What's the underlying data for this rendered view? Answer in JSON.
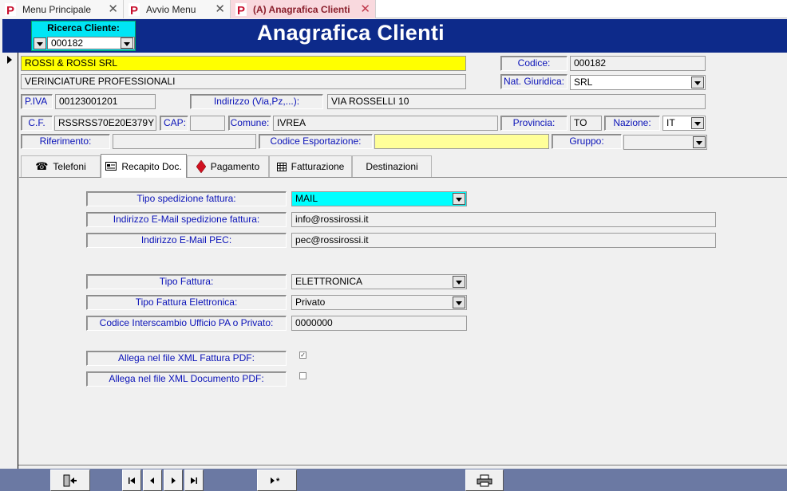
{
  "tabs": [
    {
      "label": "Menu Principale",
      "active": false
    },
    {
      "label": "Avvio Menu",
      "active": false
    },
    {
      "label": "(A) Anagrafica Clienti",
      "active": true
    }
  ],
  "header": {
    "title": "Anagrafica Clienti",
    "search_label": "Ricerca Cliente:",
    "search_value": "000182"
  },
  "client": {
    "name": "ROSSI & ROSSI SRL",
    "description": "VERINCIATURE PROFESSIONALI",
    "codice_label": "Codice:",
    "codice": "000182",
    "nat_giuridica_label": "Nat. Giuridica:",
    "nat_giuridica": "SRL",
    "piva_label": "P.IVA",
    "piva": "00123001201",
    "indirizzo_label": "Indirizzo (Via,Pz,...):",
    "indirizzo": "VIA ROSSELLI 10",
    "cf_label": "C.F.",
    "cf": "RSSRSS70E20E379Y",
    "cap_label": "CAP:",
    "cap": "",
    "comune_label": "Comune:",
    "comune": "IVREA",
    "provincia_label": "Provincia:",
    "provincia": "TO",
    "nazione_label": "Nazione:",
    "nazione": "IT",
    "riferimento_label": "Riferimento:",
    "riferimento": "",
    "codice_esportazione_label": "Codice Esportazione:",
    "codice_esportazione": "",
    "gruppo_label": "Gruppo:",
    "gruppo": ""
  },
  "subtabs": [
    {
      "label": "Telefoni",
      "icon": "phone-icon"
    },
    {
      "label": "Recapito Doc.",
      "icon": "address-card-icon"
    },
    {
      "label": "Pagamento",
      "icon": "diamond-icon"
    },
    {
      "label": "Fatturazione",
      "icon": "table-icon"
    },
    {
      "label": "Destinazioni",
      "icon": ""
    }
  ],
  "recapito": {
    "tipo_spedizione_label": "Tipo spedizione fattura:",
    "tipo_spedizione": "MAIL",
    "email_label": "Indirizzo E-Mail spedizione fattura:",
    "email": "info@rossirossi.it",
    "pec_label": "Indirizzo E-Mail PEC:",
    "pec": "pec@rossirossi.it",
    "tipo_fattura_label": "Tipo Fattura:",
    "tipo_fattura": "ELETTRONICA",
    "tipo_fattura_el_label": "Tipo Fattura Elettronica:",
    "tipo_fattura_el": "Privato",
    "codice_interscambio_label": "Codice  Interscambio Ufficio PA o Privato:",
    "codice_interscambio": "0000000",
    "allega_fattura_label": "Allega nel file XML Fattura PDF:",
    "allega_fattura_checked": true,
    "allega_documento_label": "Allega nel file XML Documento PDF:",
    "allega_documento_checked": false
  },
  "colors": {
    "header_bg": "#0d2a8a",
    "label_text": "#0a12b8",
    "navbar_bg": "#6b79a3",
    "highlight_yellow": "#ffff00",
    "highlight_cyan": "#00ffff"
  }
}
